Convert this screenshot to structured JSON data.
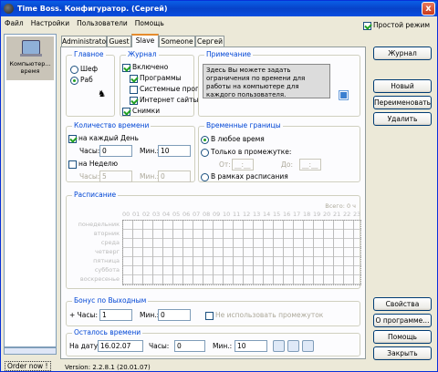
{
  "window": {
    "title": "Time Boss. Конфигуратор. (Сергей)",
    "close": "x"
  },
  "menu": [
    "Файл",
    "Настройки",
    "Пользователи",
    "Помощь"
  ],
  "simple_mode": {
    "label": "Простой режим",
    "checked": true
  },
  "left": {
    "item": "Компьютер... время",
    "order": "Order now !"
  },
  "version": "Version: 2.2.8.1 (20.01.07)",
  "tabs": [
    "Administrator",
    "Guest",
    "Slave",
    "Someone",
    "Сергей"
  ],
  "main": {
    "title": "Главное",
    "shef": "Шеф",
    "rab": "Раб"
  },
  "journal": {
    "title": "Журнал",
    "enabled": "Включено",
    "programs": "Программы",
    "system": "Системные прог",
    "internet": "Интернет сайты",
    "shots": "Снимки"
  },
  "note": {
    "title": "Примечание",
    "text": "Здесь Вы можете задать ограничения по времени для работы на компьютере для каждого пользователя."
  },
  "amount": {
    "title": "Количество времени",
    "per_day": "на каждый День",
    "hours": "Часы:",
    "mins": "Мин.:",
    "day_h": "0",
    "day_m": "10",
    "per_week": "на Неделю",
    "week_h": "5",
    "week_m": "0"
  },
  "bounds": {
    "title": "Временные границы",
    "any": "В любое время",
    "only": "Только в промежутке:",
    "from": "От:",
    "to": "До:",
    "from_v": "__:__",
    "to_v": "__:__",
    "sched": "В рамках расписания"
  },
  "schedule": {
    "title": "Расписание",
    "total": "Всего: 0 ч",
    "hours": [
      "00",
      "01",
      "02",
      "03",
      "04",
      "05",
      "06",
      "07",
      "08",
      "09",
      "10",
      "11",
      "12",
      "13",
      "14",
      "15",
      "16",
      "17",
      "18",
      "19",
      "20",
      "21",
      "22",
      "23"
    ],
    "days": [
      "понедельник",
      "вторник",
      "среда",
      "четверг",
      "пятница",
      "суббота",
      "воскресенье"
    ]
  },
  "bonus": {
    "title": "Бонус по Выходным",
    "hours": "+ Часы:",
    "h": "1",
    "mins": "Мин.:",
    "m": "0",
    "nointerval": "Не использовать промежуток"
  },
  "left_time": {
    "title": "Осталось времени",
    "date_lbl": "На дату:",
    "date": "16.02.07",
    "hours": "Часы:",
    "h": "0",
    "mins": "Мин.:",
    "m": "10"
  },
  "buttons": {
    "journal": "Журнал",
    "new": "Новый",
    "rename": "Переименовать",
    "delete": "Удалить",
    "props": "Свойства",
    "about": "О программе...",
    "help": "Помощь",
    "close": "Закрыть"
  }
}
